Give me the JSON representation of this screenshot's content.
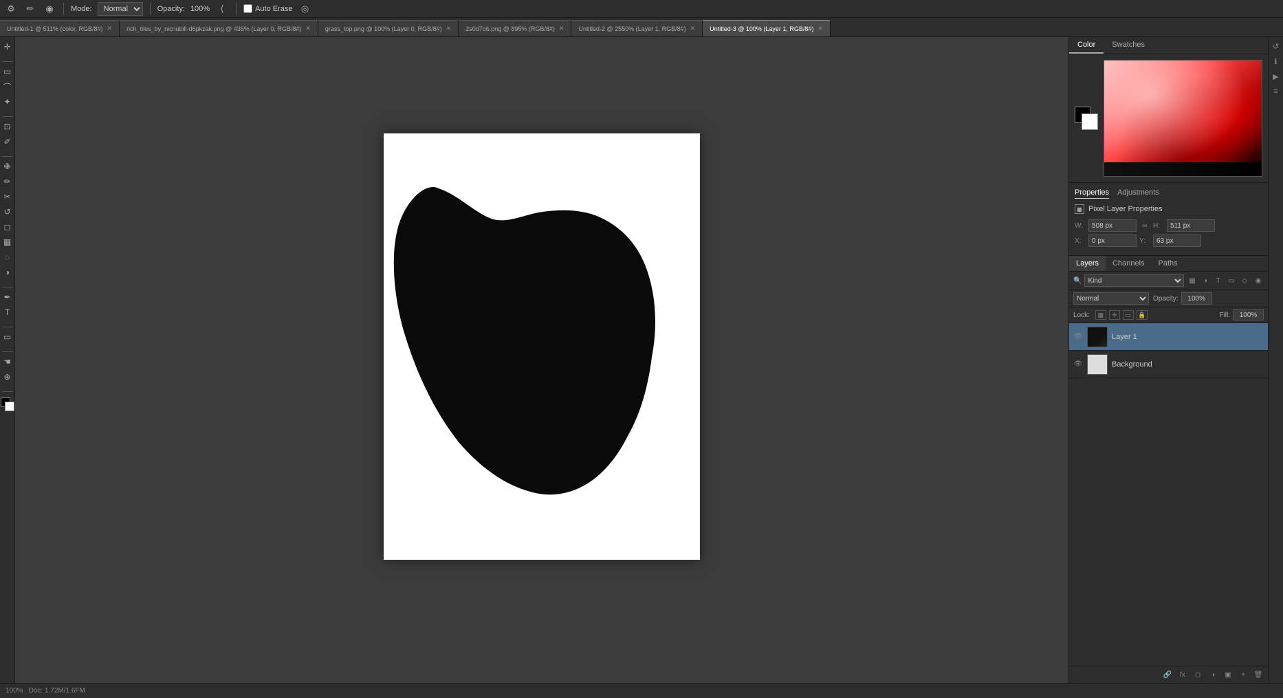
{
  "toolbar": {
    "mode_label": "Mode:",
    "mode_value": "Normal",
    "opacity_label": "Opacity:",
    "opacity_value": "100%",
    "auto_erase_label": "Auto Erase"
  },
  "tabs": [
    {
      "label": "Untitled-1 @ 511% (color, RGB/8#)",
      "active": false,
      "closable": true
    },
    {
      "label": "rich_tiles_by_nicnubill-d6pkzak.png @ 436% (Layer 0, RGB/8#)",
      "active": false,
      "closable": true
    },
    {
      "label": "grass_top.png @ 100% (Layer 0, RGB/8#)",
      "active": false,
      "closable": true
    },
    {
      "label": "2s0d7o6.png @ 895% (RGB/8#)",
      "active": false,
      "closable": true
    },
    {
      "label": "Untitled-2 @ 2550% (Layer 1, RGB/8#)",
      "active": false,
      "closable": true
    },
    {
      "label": "Untitled-3 @ 100% (Layer 1, RGB/8#)",
      "active": true,
      "closable": true
    }
  ],
  "color_panel": {
    "tab_color": "Color",
    "tab_swatches": "Swatches"
  },
  "properties_panel": {
    "tab_properties": "Properties",
    "tab_adjustments": "Adjustments",
    "title": "Pixel Layer Properties",
    "w_label": "W:",
    "w_value": "508 px",
    "h_label": "H:",
    "h_value": "511 px",
    "x_label": "X:",
    "x_value": "0 px",
    "y_label": "Y:",
    "y_value": "63 px"
  },
  "layers_panel": {
    "tab_layers": "Layers",
    "tab_channels": "Channels",
    "tab_paths": "Paths",
    "filter_label": "Kind",
    "blend_mode": "Normal",
    "opacity_label": "Opacity:",
    "opacity_value": "100%",
    "lock_label": "Lock:",
    "fill_label": "Fill:",
    "fill_value": "100%",
    "layers": [
      {
        "name": "Layer 1",
        "visible": true,
        "type": "black",
        "selected": true
      },
      {
        "name": "Background",
        "visible": true,
        "type": "white",
        "selected": false
      }
    ]
  },
  "status_bar": {
    "zoom": "100%",
    "doc_size": "Doc: 1.72M/1.6FM"
  },
  "icons": {
    "eye": "👁",
    "close": "✕",
    "chevron": "❯",
    "search": "🔍",
    "lock": "🔒",
    "link": "🔗"
  }
}
